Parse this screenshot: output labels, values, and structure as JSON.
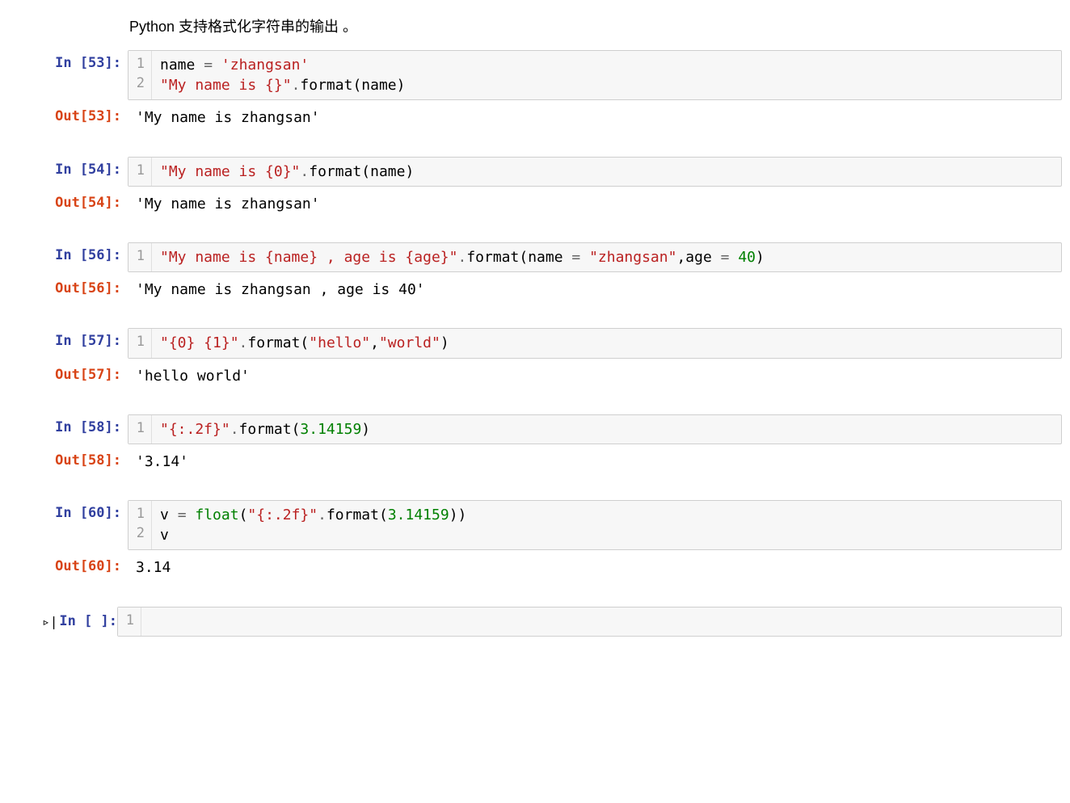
{
  "markdown": {
    "text": "Python 支持格式化字符串的输出 。"
  },
  "cells": [
    {
      "in_prompt": "In [53]:",
      "out_prompt": "Out[53]:",
      "line_numbers": [
        "1",
        "2"
      ],
      "tokens": [
        {
          "t": "name",
          "v": "name"
        },
        {
          "t": "plain",
          "v": " "
        },
        {
          "t": "op",
          "v": "="
        },
        {
          "t": "plain",
          "v": " "
        },
        {
          "t": "str",
          "v": "'zhangsan'"
        },
        {
          "t": "nl",
          "v": "\n"
        },
        {
          "t": "str",
          "v": "\"My name is {}\""
        },
        {
          "t": "op",
          "v": "."
        },
        {
          "t": "name",
          "v": "format"
        },
        {
          "t": "punct",
          "v": "("
        },
        {
          "t": "name",
          "v": "name"
        },
        {
          "t": "punct",
          "v": ")"
        }
      ],
      "output": "'My name is zhangsan'"
    },
    {
      "in_prompt": "In [54]:",
      "out_prompt": "Out[54]:",
      "line_numbers": [
        "1"
      ],
      "tokens": [
        {
          "t": "str",
          "v": "\"My name is {0}\""
        },
        {
          "t": "op",
          "v": "."
        },
        {
          "t": "name",
          "v": "format"
        },
        {
          "t": "punct",
          "v": "("
        },
        {
          "t": "name",
          "v": "name"
        },
        {
          "t": "punct",
          "v": ")"
        }
      ],
      "output": "'My name is zhangsan'"
    },
    {
      "in_prompt": "In [56]:",
      "out_prompt": "Out[56]:",
      "line_numbers": [
        "1"
      ],
      "tokens": [
        {
          "t": "str",
          "v": "\"My name is {name} , age is {age}\""
        },
        {
          "t": "op",
          "v": "."
        },
        {
          "t": "name",
          "v": "format"
        },
        {
          "t": "punct",
          "v": "("
        },
        {
          "t": "name",
          "v": "name"
        },
        {
          "t": "plain",
          "v": " "
        },
        {
          "t": "op",
          "v": "="
        },
        {
          "t": "plain",
          "v": " "
        },
        {
          "t": "str",
          "v": "\"zhangsan\""
        },
        {
          "t": "punct",
          "v": ","
        },
        {
          "t": "name",
          "v": "age"
        },
        {
          "t": "plain",
          "v": " "
        },
        {
          "t": "op",
          "v": "="
        },
        {
          "t": "plain",
          "v": " "
        },
        {
          "t": "num",
          "v": "40"
        },
        {
          "t": "punct",
          "v": ")"
        }
      ],
      "output": "'My name is zhangsan , age is 40'"
    },
    {
      "in_prompt": "In [57]:",
      "out_prompt": "Out[57]:",
      "line_numbers": [
        "1"
      ],
      "tokens": [
        {
          "t": "str",
          "v": "\"{0} {1}\""
        },
        {
          "t": "op",
          "v": "."
        },
        {
          "t": "name",
          "v": "format"
        },
        {
          "t": "punct",
          "v": "("
        },
        {
          "t": "str",
          "v": "\"hello\""
        },
        {
          "t": "punct",
          "v": ","
        },
        {
          "t": "str",
          "v": "\"world\""
        },
        {
          "t": "punct",
          "v": ")"
        }
      ],
      "output": "'hello world'"
    },
    {
      "in_prompt": "In [58]:",
      "out_prompt": "Out[58]:",
      "line_numbers": [
        "1"
      ],
      "tokens": [
        {
          "t": "str",
          "v": "\"{:.2f}\""
        },
        {
          "t": "op",
          "v": "."
        },
        {
          "t": "name",
          "v": "format"
        },
        {
          "t": "punct",
          "v": "("
        },
        {
          "t": "num",
          "v": "3.14159"
        },
        {
          "t": "punct",
          "v": ")"
        }
      ],
      "output": "'3.14'"
    },
    {
      "in_prompt": "In [60]:",
      "out_prompt": "Out[60]:",
      "line_numbers": [
        "1",
        "2"
      ],
      "tokens": [
        {
          "t": "name",
          "v": "v"
        },
        {
          "t": "plain",
          "v": " "
        },
        {
          "t": "op",
          "v": "="
        },
        {
          "t": "plain",
          "v": " "
        },
        {
          "t": "builtin",
          "v": "float"
        },
        {
          "t": "punct",
          "v": "("
        },
        {
          "t": "str",
          "v": "\"{:.2f}\""
        },
        {
          "t": "op",
          "v": "."
        },
        {
          "t": "name",
          "v": "format"
        },
        {
          "t": "punct",
          "v": "("
        },
        {
          "t": "num",
          "v": "3.14159"
        },
        {
          "t": "punct",
          "v": ")"
        },
        {
          "t": "punct",
          "v": ")"
        },
        {
          "t": "nl",
          "v": "\n"
        },
        {
          "t": "name",
          "v": "v"
        }
      ],
      "output": "3.14"
    }
  ],
  "empty_cell": {
    "in_prompt": "In [ ]:",
    "line_numbers": [
      "1"
    ],
    "run_icon": "▹|"
  }
}
